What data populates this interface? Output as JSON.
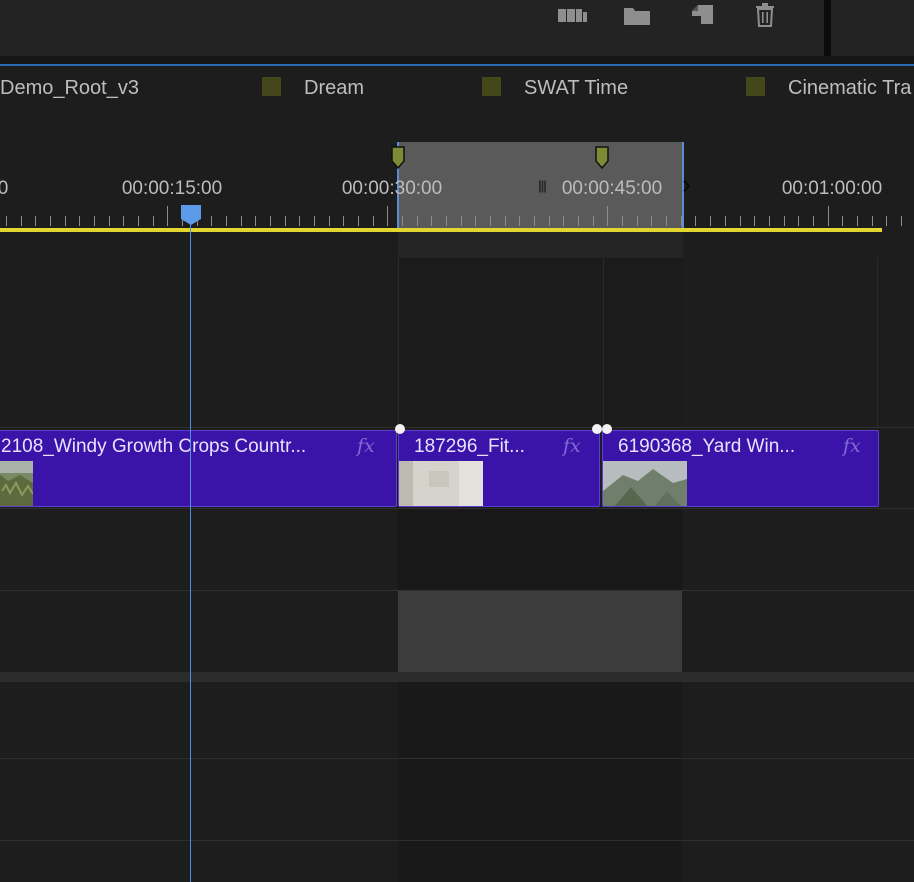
{
  "toolbar": {
    "icons": [
      "sequence-bin-icon",
      "folder-icon",
      "new-item-icon",
      "trash-icon"
    ]
  },
  "tabs": [
    {
      "label": "Demo_Root_v3",
      "has_swatch": false
    },
    {
      "label": "Dream",
      "swatch_color": "#44471a"
    },
    {
      "label": "SWAT Time",
      "swatch_color": "#44471a"
    },
    {
      "label": "Cinematic Tra",
      "swatch_color": "#44471a"
    }
  ],
  "ruler": {
    "timecodes": [
      "0",
      "00:00:15:00",
      "00:00:30:00",
      "00:00:45:00",
      "00:01:00:00"
    ],
    "range_handle": "|||"
  },
  "clips": [
    {
      "name": "2108_Windy Growth Crops Countr...",
      "fx": "fx"
    },
    {
      "name": "187296_Fit...",
      "fx": "fx"
    },
    {
      "name": "6190368_Yard Win...",
      "fx": "fx"
    }
  ],
  "colors": {
    "clip": "#3a14a8",
    "playhead": "#4d8fe0",
    "work_area_bar": "#e3d72f",
    "marker": "#8a9a40"
  }
}
